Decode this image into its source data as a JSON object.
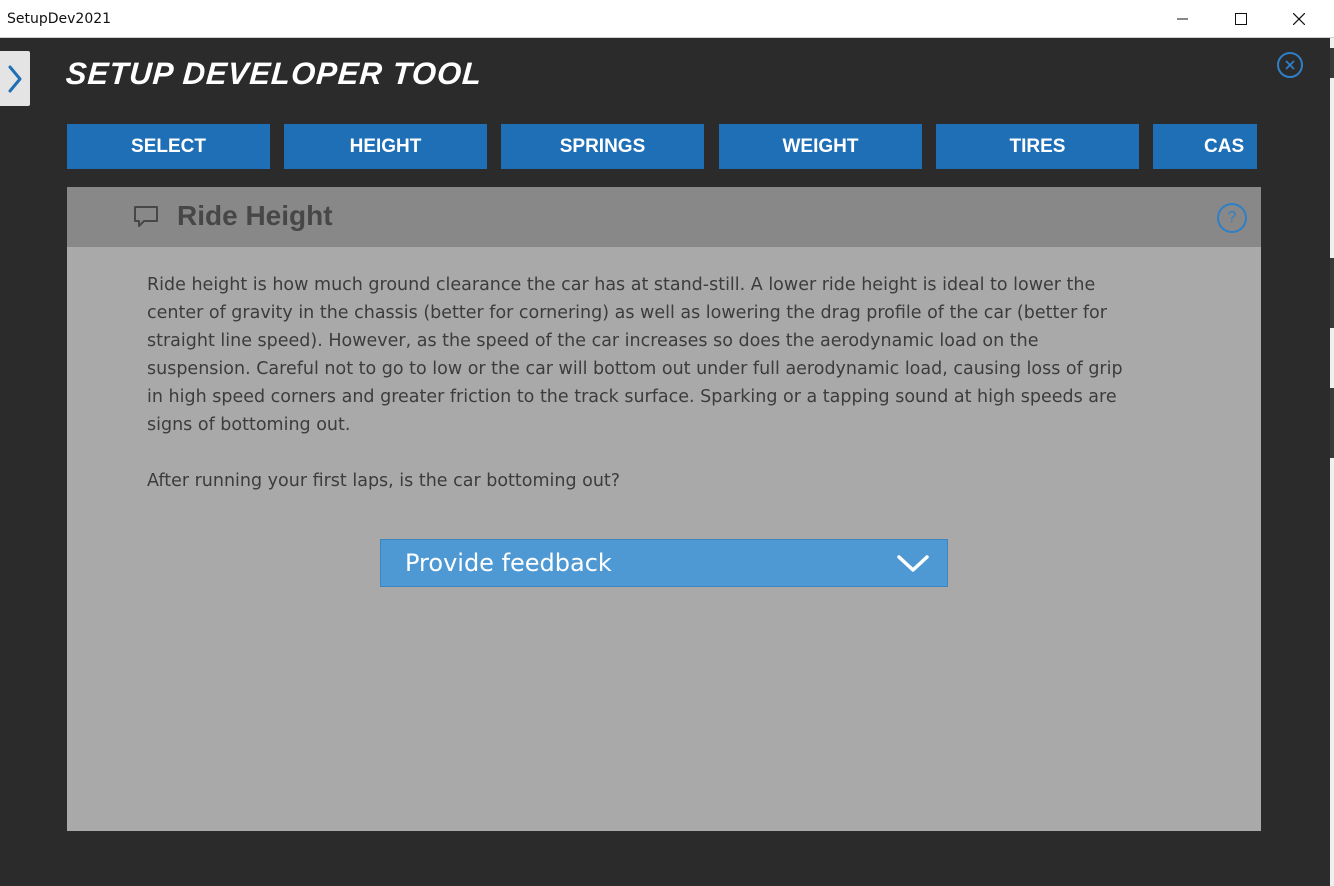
{
  "window": {
    "title": "SetupDev2021",
    "controls": [
      "minimize",
      "maximize",
      "close"
    ]
  },
  "app": {
    "title": "SETUP DEVELOPER TOOL",
    "sidebar_toggle_icon": "chevron-right-icon",
    "close_icon": "close-circle-icon",
    "accent_color": "#1f6fb7"
  },
  "tabs": [
    {
      "label": "SELECT"
    },
    {
      "label": "HEIGHT"
    },
    {
      "label": "SPRINGS"
    },
    {
      "label": "WEIGHT"
    },
    {
      "label": "TIRES"
    },
    {
      "label": "CAS"
    }
  ],
  "panel": {
    "title": "Ride Height",
    "title_icon": "chat-bubble-icon",
    "help_icon": "help-circle-icon",
    "help_text": "?",
    "description": "Ride height is how much ground clearance the car has at stand-still. A lower ride height is ideal to lower the center of gravity in the chassis (better for cornering) as well as lowering the drag profile of the car (better for straight line speed). However, as the speed of the car increases so does the aerodynamic load on the suspension. Careful not to go to low or the car will bottom out under full aerodynamic load, causing loss of grip in high speed corners and greater friction to the track surface. Sparking or a tapping sound at high speeds are signs of bottoming out.",
    "question": "After running your first laps, is the car bottoming out?",
    "dropdown": {
      "selected": "Provide feedback",
      "icon": "chevron-down-icon"
    }
  }
}
